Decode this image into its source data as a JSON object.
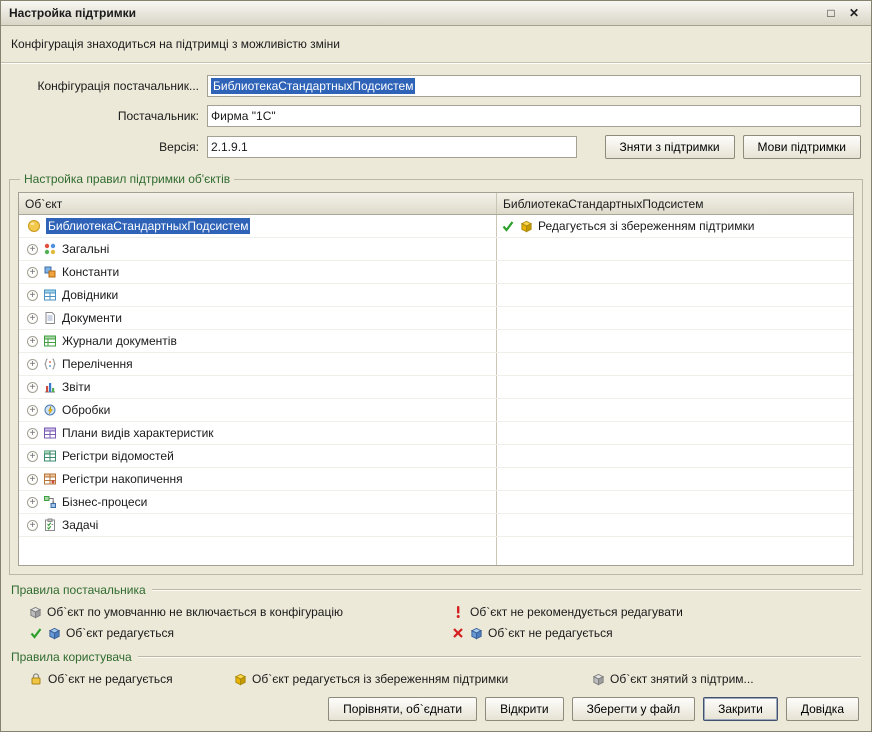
{
  "colors": {
    "selection": "#2e63b8",
    "group_title_green": "#2f6b2f",
    "window_bg": "#ece9d8"
  },
  "window": {
    "title": "Настройка підтримки",
    "maximize_glyph": "□",
    "close_glyph": "✕",
    "status_line": "Конфігурація знаходиться на підтримці з можливістю зміни"
  },
  "form": {
    "vendor_config": {
      "label": "Конфігурація постачальник...",
      "value": "БиблиотекаСтандартныхПодсистем"
    },
    "supplier": {
      "label": "Постачальник:",
      "value": "Фирма \"1С\""
    },
    "version": {
      "label": "Версія:",
      "value": "2.1.9.1"
    },
    "buttons": {
      "remove_support": "Зняти з підтримки",
      "support_languages": "Мови підтримки"
    }
  },
  "object_tree": {
    "group_title": "Настройка правил підтримки об'єктів",
    "columns": {
      "object": "Об`єкт",
      "library": "БиблиотекаСтандартныхПодсистем"
    },
    "root": {
      "label": "БиблиотекаСтандартныхПодсистем",
      "status": "Редагується зі збереженням підтримки"
    },
    "expander_glyph": "+",
    "rows": [
      "Загальні",
      "Константи",
      "Довідники",
      "Документи",
      "Журнали документів",
      "Перелічення",
      "Звіти",
      "Обробки",
      "Плани видів характеристик",
      "Регістри відомостей",
      "Регістри накопичення",
      "Бізнес-процеси",
      "Задачі"
    ]
  },
  "provider_rules": {
    "title": "Правила постачальника",
    "items": [
      "Об`єкт по умовчанню не включається в конфігурацію",
      "Об`єкт не рекомендується редагувати",
      "Об`єкт редагується",
      "Об`єкт не редагується"
    ]
  },
  "user_rules": {
    "title": "Правила користувача",
    "items": [
      "Об`єкт не редагується",
      "Об`єкт редагується із збереженням підтримки",
      "Об`єкт знятий з підтрим..."
    ]
  },
  "footer": {
    "buttons": {
      "compare": "Порівняти, об`єднати",
      "open": "Відкрити",
      "save": "Зберегти у файл",
      "close": "Закрити",
      "help": "Довідка"
    }
  }
}
